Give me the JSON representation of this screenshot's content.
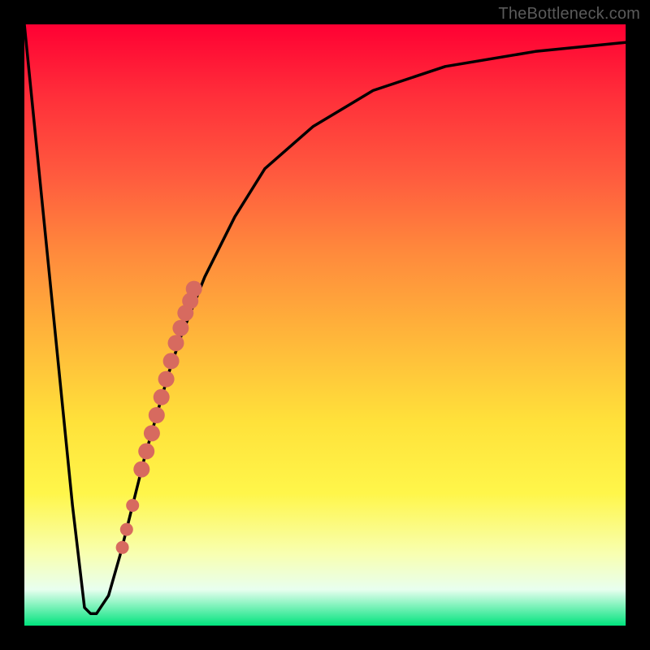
{
  "watermark": "TheBottleneck.com",
  "colors": {
    "frame": "#000000",
    "curve": "#000000",
    "dots": "#d76a5f",
    "gradient_top": "#ff0033",
    "gradient_bottom": "#00e37d"
  },
  "chart_data": {
    "type": "line",
    "title": "",
    "xlabel": "",
    "ylabel": "",
    "xlim": [
      0,
      100
    ],
    "ylim": [
      0,
      100
    ],
    "grid": false,
    "legend": false,
    "series": [
      {
        "name": "bottleneck-curve",
        "x": [
          0,
          4,
          8,
          10,
          11,
          12,
          14,
          16,
          18,
          20,
          22,
          24,
          26,
          30,
          35,
          40,
          48,
          58,
          70,
          85,
          100
        ],
        "y": [
          100,
          60,
          20,
          3,
          2,
          2,
          5,
          12,
          20,
          28,
          35,
          42,
          48,
          58,
          68,
          76,
          83,
          89,
          93,
          95.5,
          97
        ]
      }
    ],
    "highlight_points": {
      "name": "marked-range",
      "x": [
        19.5,
        20.3,
        21.2,
        22.0,
        22.8,
        23.6,
        24.4,
        25.2,
        26.0,
        26.8,
        27.6,
        28.2,
        18.0,
        17.0,
        16.3
      ],
      "y": [
        26.0,
        29.0,
        32.0,
        35.0,
        38.0,
        41.0,
        44.0,
        47.0,
        49.5,
        52.0,
        54.0,
        56.0,
        20.0,
        16.0,
        13.0
      ]
    }
  }
}
